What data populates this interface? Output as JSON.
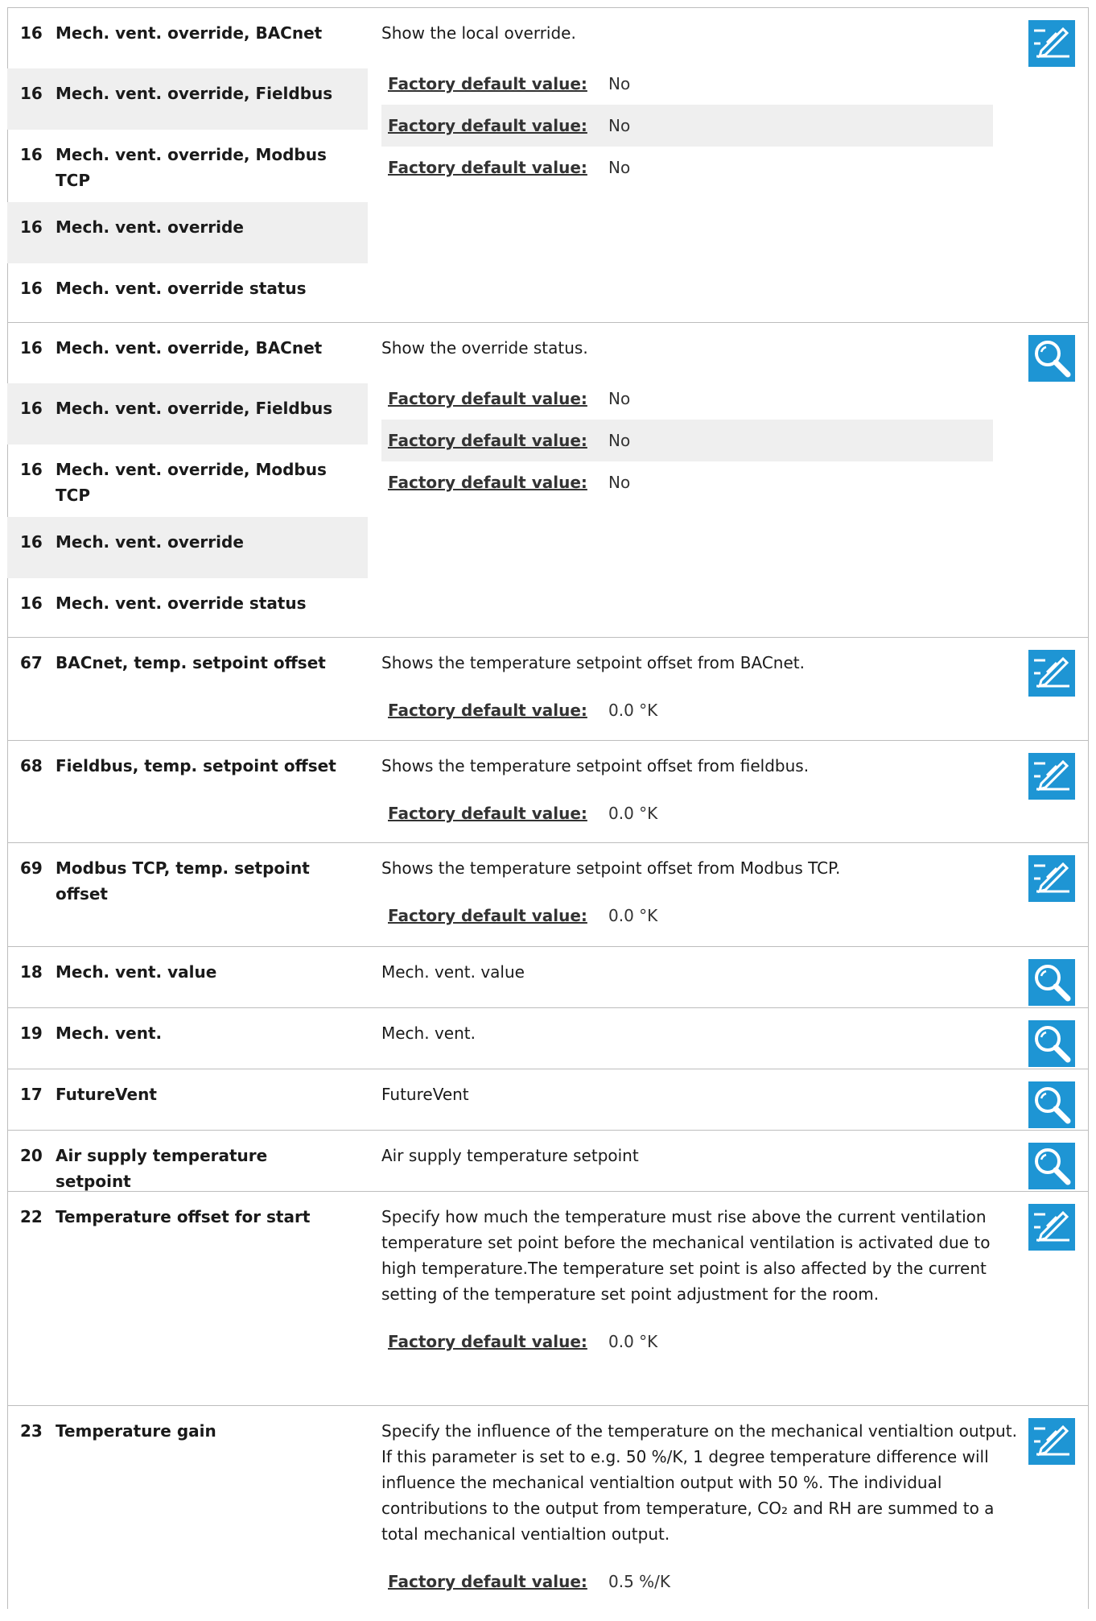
{
  "factory_label": "Factory default value:",
  "groups": [
    {
      "names": [
        {
          "num": "16",
          "name": "Mech. vent. override, BACnet"
        },
        {
          "num": "16",
          "name": "Mech. vent. override, Fieldbus"
        },
        {
          "num": "16",
          "name": "Mech. vent. override, Modbus TCP"
        },
        {
          "num": "16",
          "name": "Mech. vent. override"
        },
        {
          "num": "16",
          "name": "Mech. vent. override status"
        }
      ],
      "description": "Show the local override.",
      "defaults": [
        "No",
        "No",
        "No"
      ],
      "icon": "edit-icon"
    },
    {
      "names": [
        {
          "num": "16",
          "name": "Mech. vent. override, BACnet"
        },
        {
          "num": "16",
          "name": "Mech. vent. override, Fieldbus"
        },
        {
          "num": "16",
          "name": "Mech. vent. override, Modbus TCP"
        },
        {
          "num": "16",
          "name": "Mech. vent. override"
        },
        {
          "num": "16",
          "name": "Mech. vent. override status"
        }
      ],
      "description": "Show the override status.",
      "defaults": [
        "No",
        "No",
        "No"
      ],
      "icon": "magnifier-icon"
    }
  ],
  "params": [
    {
      "num": "67",
      "name": "BACnet, temp. setpoint offset",
      "description": "Shows the temperature setpoint offset from BACnet.",
      "default": "0.0 °K",
      "icon": "edit-icon"
    },
    {
      "num": "68",
      "name": "Fieldbus, temp. setpoint offset",
      "description": "Shows the temperature setpoint offset from fieldbus.",
      "default": "0.0 °K",
      "icon": "edit-icon"
    },
    {
      "num": "69",
      "name": "Modbus TCP, temp. setpoint offset",
      "description": "Shows the temperature setpoint offset from Modbus TCP.",
      "default": "0.0 °K",
      "icon": "edit-icon"
    },
    {
      "num": "18",
      "name": "Mech. vent. value",
      "description": "Mech. vent. value",
      "icon": "magnifier-icon"
    },
    {
      "num": "19",
      "name": "Mech. vent.",
      "description": "Mech. vent.",
      "icon": "magnifier-icon"
    },
    {
      "num": "17",
      "name": "FutureVent",
      "description": "FutureVent",
      "icon": "magnifier-icon"
    },
    {
      "num": "20",
      "name": "Air supply temperature setpoint",
      "description": "Air supply temperature setpoint",
      "icon": "magnifier-icon"
    },
    {
      "num": "22",
      "name": "Temperature offset for start",
      "description": "Specify how much the temperature must rise above the current ventilation temperature set point before the mechanical ventilation is activated due to high temperature.The temperature set point is also affected by the current setting of the temperature set point adjustment for the room.",
      "default": "0.0 °K",
      "icon": "edit-icon"
    },
    {
      "num": "23",
      "name": "Temperature gain",
      "description": "Specify the influence of the temperature on the mechanical ventialtion output. If this parameter is set to e.g. 50 %/K, 1 degree temperature difference will influence the mechanical ventialtion output with 50 %. The individual contributions to the output from temperature, CO₂ and RH are summed to a total mechanical ventialtion output.",
      "default": "0.5 %/K",
      "icon": "edit-icon"
    }
  ]
}
